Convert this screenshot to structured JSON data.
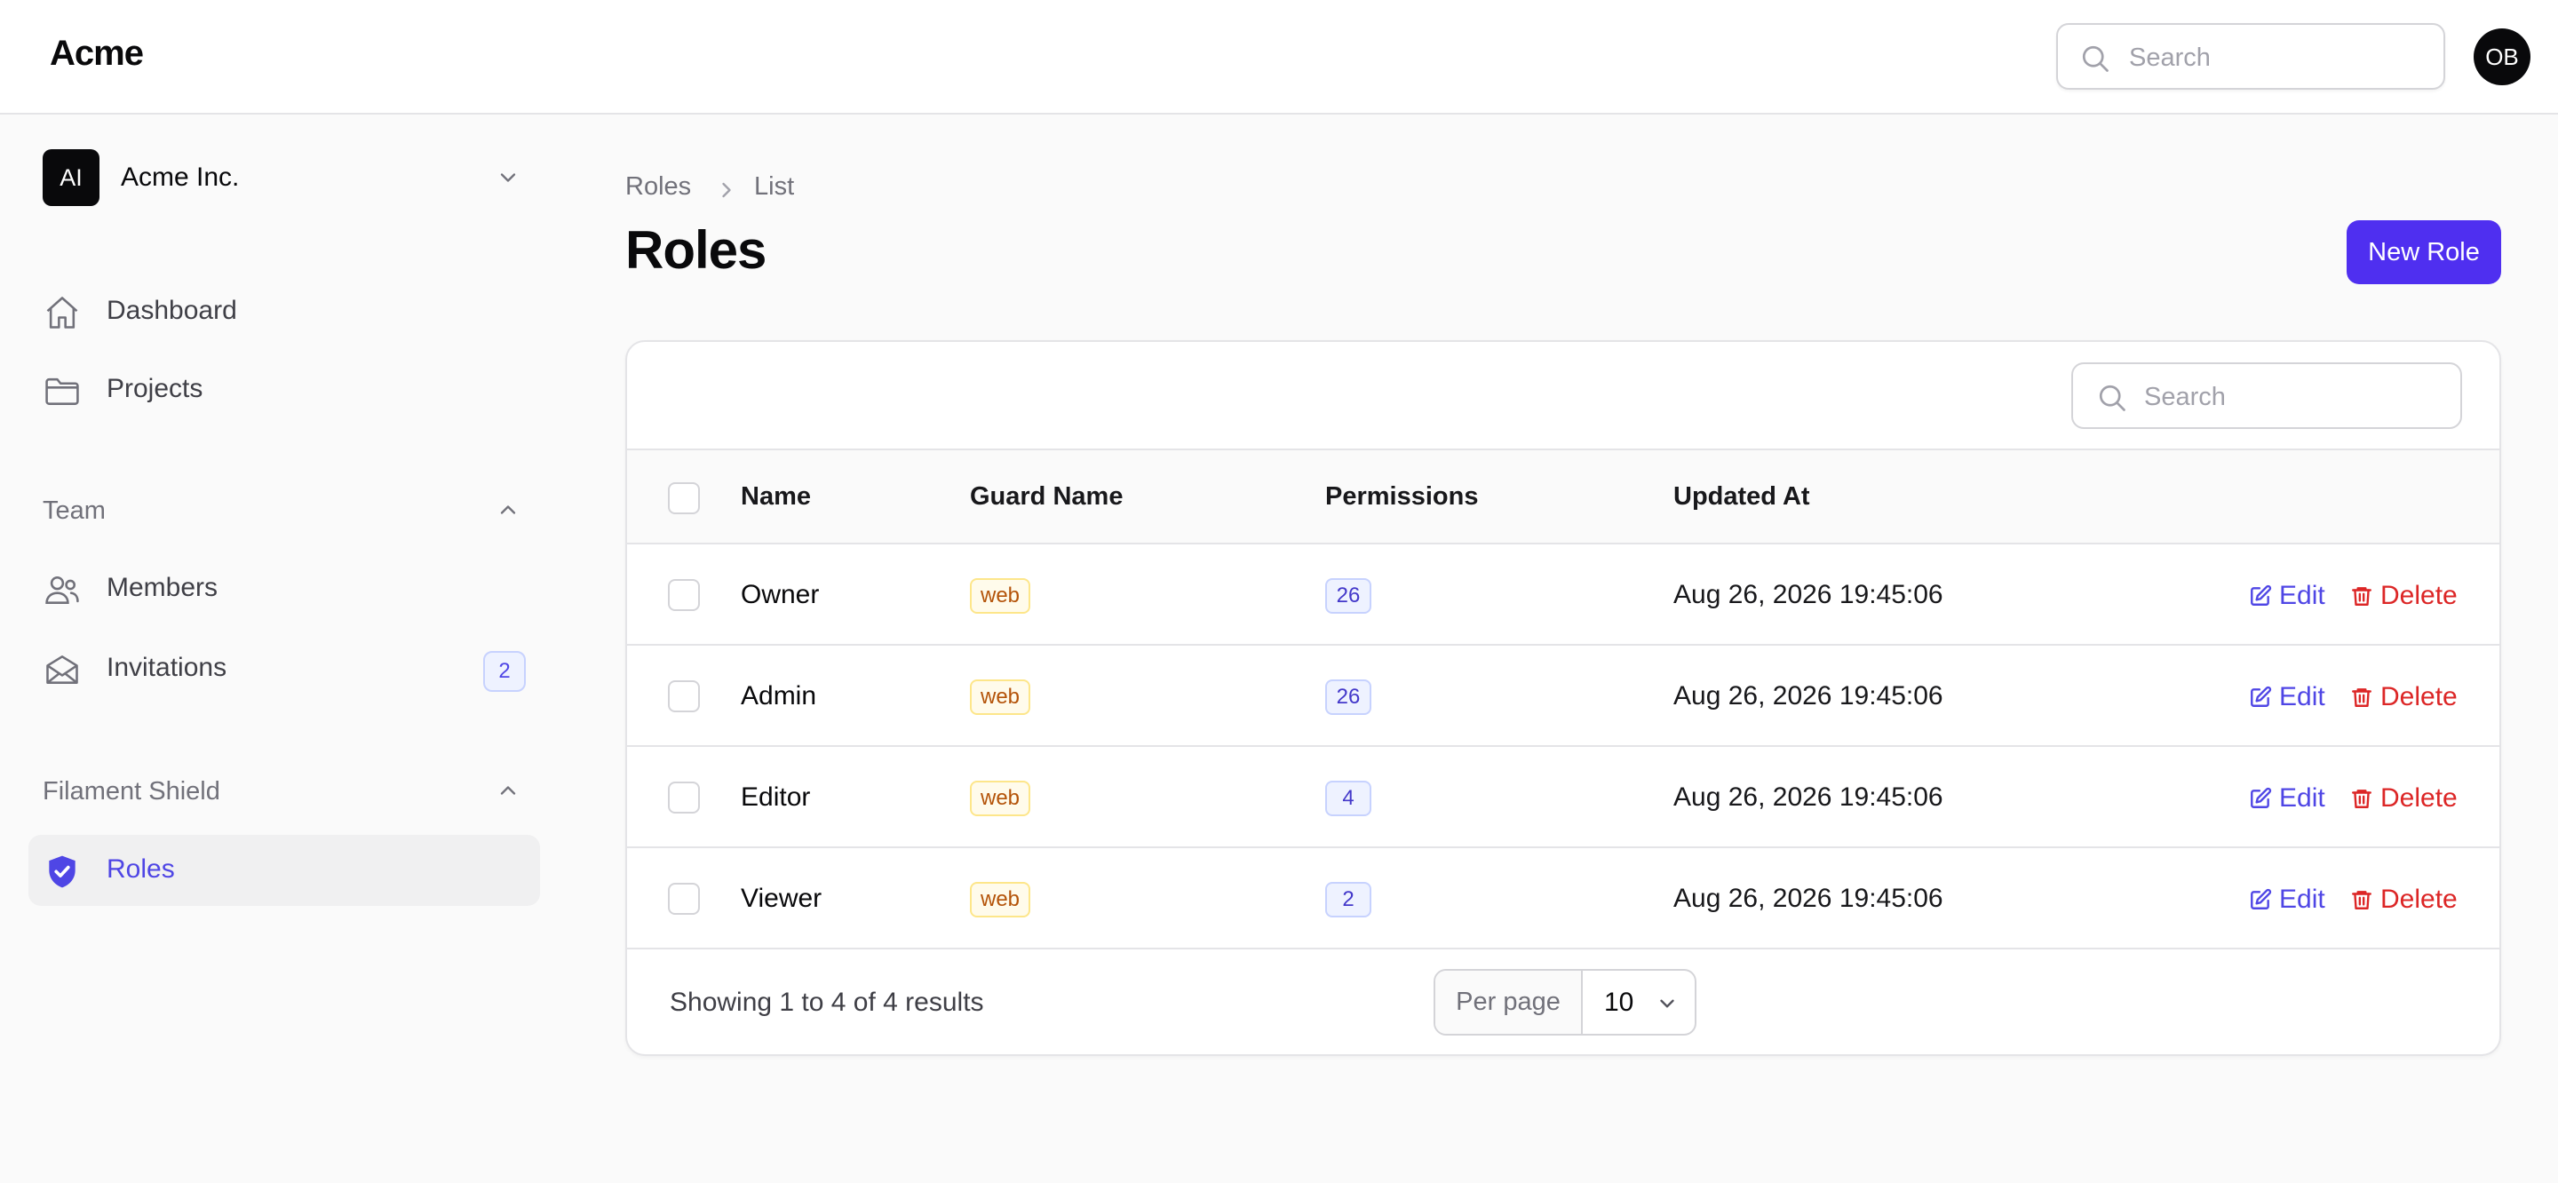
{
  "app": {
    "brand": "Acme",
    "user_initials": "OB"
  },
  "top_search": {
    "placeholder": "Search"
  },
  "tenant": {
    "initials": "AI",
    "name": "Acme Inc."
  },
  "sidebar": {
    "items": [
      {
        "label": "Dashboard",
        "icon": "home-icon"
      },
      {
        "label": "Projects",
        "icon": "folder-icon"
      }
    ],
    "groups": [
      {
        "label": "Team",
        "items": [
          {
            "label": "Members",
            "icon": "users-icon"
          },
          {
            "label": "Invitations",
            "icon": "envelope-open-icon",
            "count": "2"
          }
        ]
      },
      {
        "label": "Filament Shield",
        "items": [
          {
            "label": "Roles",
            "icon": "shield-check-icon",
            "active": true
          }
        ]
      }
    ]
  },
  "breadcrumb": {
    "root": "Roles",
    "current": "List"
  },
  "page": {
    "title": "Roles",
    "new_button": "New Role"
  },
  "table": {
    "search_placeholder": "Search",
    "columns": [
      "Name",
      "Guard Name",
      "Permissions",
      "Updated At"
    ],
    "rows": [
      {
        "name": "Owner",
        "guard": "web",
        "permissions": "26",
        "updated_at": "Aug 26, 2026 19:45:06"
      },
      {
        "name": "Admin",
        "guard": "web",
        "permissions": "26",
        "updated_at": "Aug 26, 2026 19:45:06"
      },
      {
        "name": "Editor",
        "guard": "web",
        "permissions": "4",
        "updated_at": "Aug 26, 2026 19:45:06"
      },
      {
        "name": "Viewer",
        "guard": "web",
        "permissions": "2",
        "updated_at": "Aug 26, 2026 19:45:06"
      }
    ],
    "actions": {
      "edit": "Edit",
      "delete": "Delete"
    },
    "footer": {
      "summary": "Showing 1 to 4 of 4 results",
      "per_page_label": "Per page",
      "per_page_value": "10"
    }
  },
  "colors": {
    "primary": "#4f2ff0",
    "danger": "#dc2626",
    "warning_text": "#b45309"
  }
}
